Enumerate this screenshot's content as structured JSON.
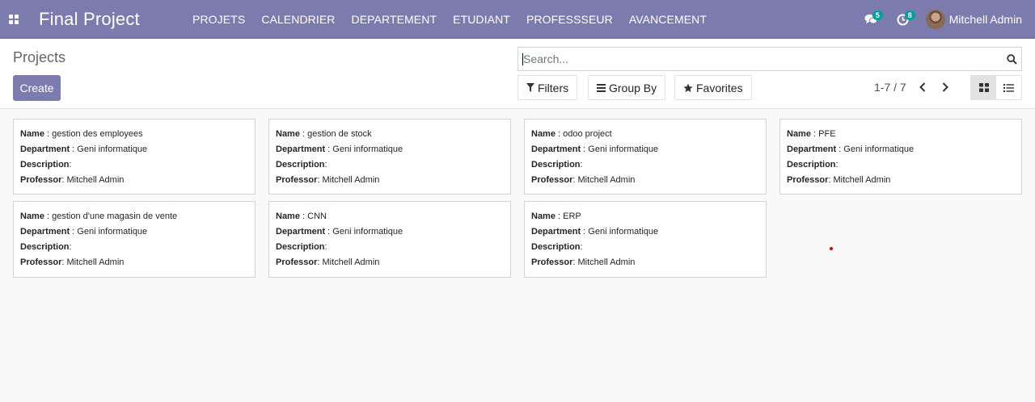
{
  "app": {
    "title": "Final Project",
    "menu": [
      "PROJETS",
      "CALENDRIER",
      "DEPARTEMENT",
      "ETUDIANT",
      "PROFESSSEUR",
      "AVANCEMENT"
    ],
    "messages_count": "5",
    "activities_count": "8",
    "user_name": "Mitchell Admin",
    "accent_color": "#7c7bad",
    "badge_color": "#00a09d"
  },
  "control_panel": {
    "breadcrumb": "Projects",
    "create_label": "Create",
    "search_placeholder": "Search...",
    "filters_label": "Filters",
    "group_by_label": "Group By",
    "favorites_label": "Favorites",
    "pager": "1-7 / 7"
  },
  "labels": {
    "name": "Name",
    "department": "Department",
    "description": "Description",
    "professor": "Professor"
  },
  "projects": [
    {
      "name": "gestion des employees",
      "department": "Geni informatique",
      "description": "",
      "professor": "Mitchell Admin"
    },
    {
      "name": "gestion de stock",
      "department": "Geni informatique",
      "description": "",
      "professor": "Mitchell Admin"
    },
    {
      "name": "odoo project",
      "department": "Geni informatique",
      "description": "",
      "professor": "Mitchell Admin"
    },
    {
      "name": "PFE",
      "department": "Geni informatique",
      "description": "",
      "professor": "Mitchell Admin"
    },
    {
      "name": "gestion d'une magasin de vente",
      "department": "Geni informatique",
      "description": "",
      "professor": "Mitchell Admin"
    },
    {
      "name": "CNN",
      "department": "Geni informatique",
      "description": "",
      "professor": "Mitchell Admin"
    },
    {
      "name": "ERP",
      "department": "Geni informatique",
      "description": "",
      "professor": "Mitchell Admin"
    }
  ]
}
